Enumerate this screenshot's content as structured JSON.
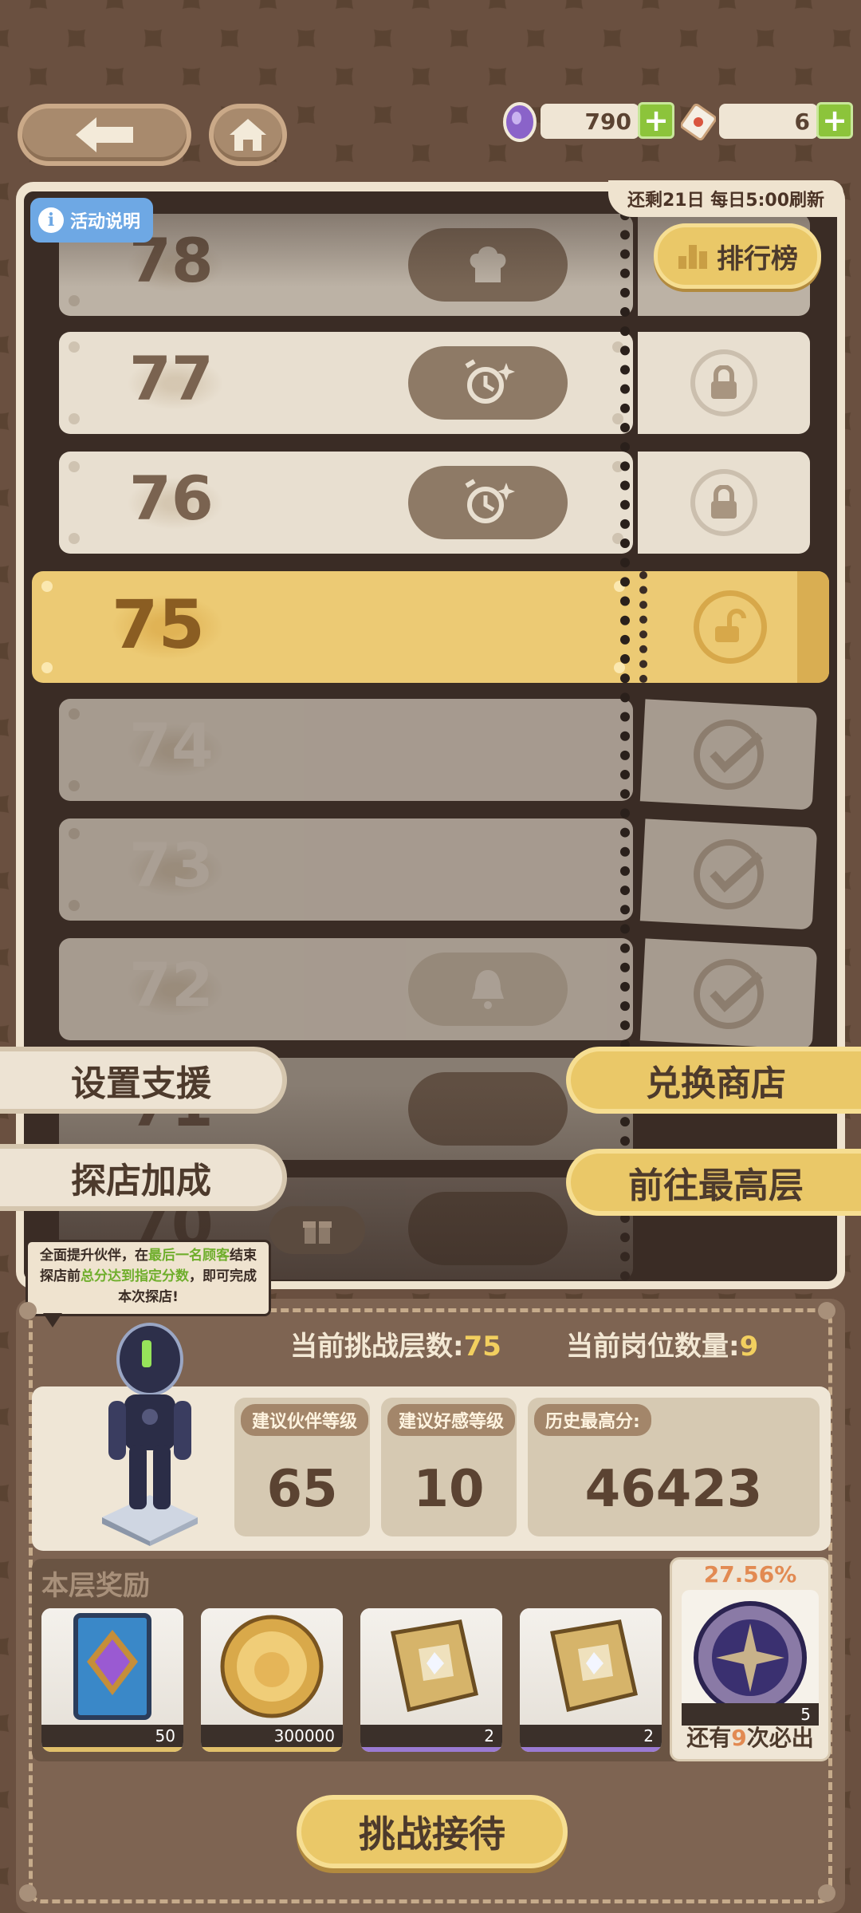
{
  "topbar": {
    "gem_count": "790",
    "ticket_count": "6",
    "plus": "+"
  },
  "panel": {
    "refresh_text": "还剩21日 每日5:00刷新",
    "info_label": "活动说明",
    "info_icon": "i",
    "ranking_label": "排行榜"
  },
  "floors": [
    {
      "num": "78",
      "state": "locked",
      "icon": "chef-hat-icon"
    },
    {
      "num": "77",
      "state": "locked",
      "icon": "alarm-clock-icon"
    },
    {
      "num": "76",
      "state": "locked",
      "icon": "alarm-clock-icon"
    },
    {
      "num": "75",
      "state": "current"
    },
    {
      "num": "74",
      "state": "done"
    },
    {
      "num": "73",
      "state": "done"
    },
    {
      "num": "72",
      "state": "done",
      "icon": "bell-icon"
    },
    {
      "num": "71",
      "state": "done",
      "icon": "energy-icon"
    },
    {
      "num": "70",
      "state": "done",
      "icon": "bow-icon"
    }
  ],
  "buttons": {
    "support": "设置支援",
    "bonus": "探店加成",
    "shop": "兑换商店",
    "highest": "前往最高层",
    "challenge": "挑战接待"
  },
  "tip": {
    "part1": "全面提升伙伴，在",
    "hl1": "最后一名顾客",
    "part2": "结束探店前",
    "hl2": "总分达到指定分数",
    "part3": "，即可完成本次探店!"
  },
  "stats": {
    "floor_label": "当前挑战层数:",
    "floor_value": "75",
    "slots_label": "当前岗位数量:",
    "slots_value": "9",
    "partner_level_label": "建议伙伴等级",
    "partner_level": "65",
    "affinity_label": "建议好感等级",
    "affinity": "10",
    "best_label": "历史最高分:",
    "best": "46423"
  },
  "rewards": {
    "title": "本层奖励",
    "items": [
      {
        "name": "purple-gem-card",
        "count": "50",
        "strip": "#e1c06a"
      },
      {
        "name": "gold-coin",
        "count": "300000",
        "strip": "#e1c06a"
      },
      {
        "name": "gold-book",
        "count": "2",
        "strip": "#9a7ad2"
      },
      {
        "name": "gold-book",
        "count": "2",
        "strip": "#9a7ad2"
      }
    ],
    "special": {
      "percent": "27.56%",
      "count": "5",
      "guarantee_pre": "还有",
      "guarantee_num": "9",
      "guarantee_post": "次必出"
    }
  },
  "colors": {
    "gold": "#eac868",
    "accent_orange": "#e28a52",
    "green": "#8cc43b",
    "hl_green": "#6fae2c",
    "hl_yellow": "#f2cf5f"
  }
}
